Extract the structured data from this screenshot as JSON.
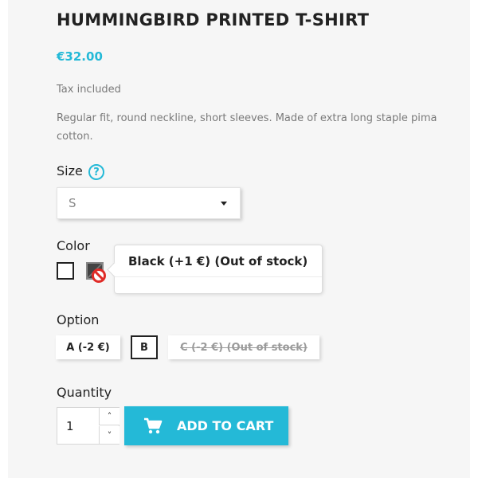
{
  "product": {
    "title": "HUMMINGBIRD PRINTED T-SHIRT",
    "price": "€32.00",
    "tax_note": "Tax included",
    "description": "Regular fit, round neckline, short sleeves. Made of extra long staple pima cotton."
  },
  "size": {
    "label": "Size",
    "help_icon": "?",
    "selected": "S"
  },
  "color": {
    "label": "Color",
    "swatches": [
      {
        "name": "white",
        "color": "#ffffff"
      },
      {
        "name": "black",
        "color": "#434343",
        "out_of_stock": true
      }
    ],
    "tooltip": "Black (+1 €) (Out of stock)"
  },
  "option": {
    "label": "Option",
    "choices": [
      {
        "label": "A (-2 €)"
      },
      {
        "label": "B",
        "selected": true
      },
      {
        "label": "C (-2 €) (Out of stock)",
        "out_of_stock": true
      }
    ]
  },
  "quantity": {
    "label": "Quantity",
    "value": "1",
    "up_icon": "˄",
    "down_icon": "˅"
  },
  "cart": {
    "button_label": "ADD TO CART",
    "icon": "shopping-cart-icon"
  },
  "colors": {
    "accent": "#24b9d7",
    "panel_bg": "#f6f6f6",
    "error": "#e02b27"
  }
}
